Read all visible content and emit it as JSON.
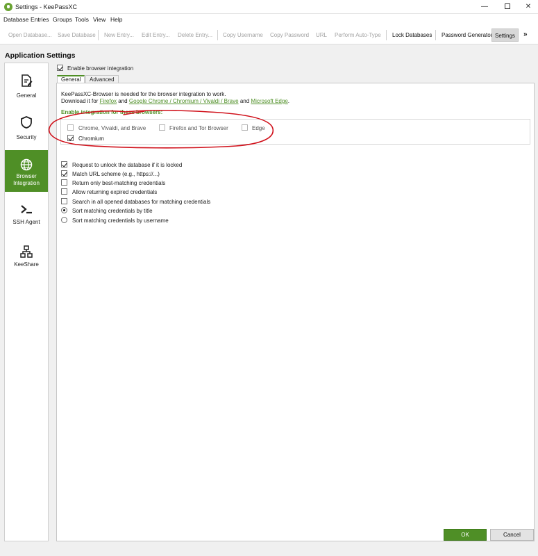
{
  "window": {
    "title": "Settings - KeePassXC"
  },
  "menu": [
    "Database",
    "Entries",
    "Groups",
    "Tools",
    "View",
    "Help"
  ],
  "toolbar": {
    "open_database": "Open Database...",
    "save_database": "Save Database",
    "new_entry": "New Entry...",
    "edit_entry": "Edit Entry...",
    "delete_entry": "Delete Entry...",
    "copy_username": "Copy Username",
    "copy_password": "Copy Password",
    "url": "URL",
    "perform_autotype": "Perform Auto-Type",
    "lock_databases": "Lock Databases",
    "password_generator": "Password Generator",
    "settings": "Settings"
  },
  "heading": "Application Settings",
  "sidebar": {
    "items": [
      {
        "label": "General",
        "icon": "document-edit-icon"
      },
      {
        "label": "Security",
        "icon": "shield-icon"
      },
      {
        "label": "Browser Integration",
        "line1": "Browser",
        "line2": "Integration",
        "icon": "globe-icon",
        "active": true
      },
      {
        "label": "SSH Agent",
        "icon": "terminal-icon"
      },
      {
        "label": "KeeShare",
        "icon": "network-icon"
      }
    ]
  },
  "browser": {
    "enable_label": "Enable browser integration",
    "enable_checked": true,
    "tabs": [
      "General",
      "Advanced"
    ],
    "info_line1": "KeePassXC-Browser is needed for the browser integration to work.",
    "download_prefix": "Download it for",
    "link_firefox": "Firefox",
    "and1": "and",
    "link_chrome": "Google Chrome / Chromium / Vivaldi / Brave",
    "and2": "and",
    "link_edge": "Microsoft Edge",
    "period": ".",
    "section_title": "Enable integration for these browsers:",
    "browsers": {
      "chrome": {
        "label": "Chrome, Vivaldi, and Brave",
        "checked": false
      },
      "firefox": {
        "label": "Firefox and Tor Browser",
        "checked": false
      },
      "edge": {
        "label": "Edge",
        "checked": false
      },
      "chromium": {
        "label": "Chromium",
        "checked": true
      }
    },
    "options": [
      {
        "label": "Request to unlock the database if it is locked",
        "checked": true
      },
      {
        "label": "Match URL scheme (e.g., https://...)",
        "checked": true
      },
      {
        "label": "Return only best-matching credentials",
        "checked": false
      },
      {
        "label": "Allow returning expired credentials",
        "checked": false
      },
      {
        "label": "Search in all opened databases for matching credentials",
        "checked": false
      }
    ],
    "sort": [
      {
        "label": "Sort matching credentials by title",
        "selected": true
      },
      {
        "label": "Sort matching credentials by username",
        "selected": false
      }
    ]
  },
  "buttons": {
    "ok": "OK",
    "cancel": "Cancel"
  },
  "colors": {
    "accent": "#4f8f26",
    "annotation": "#d0101a"
  }
}
